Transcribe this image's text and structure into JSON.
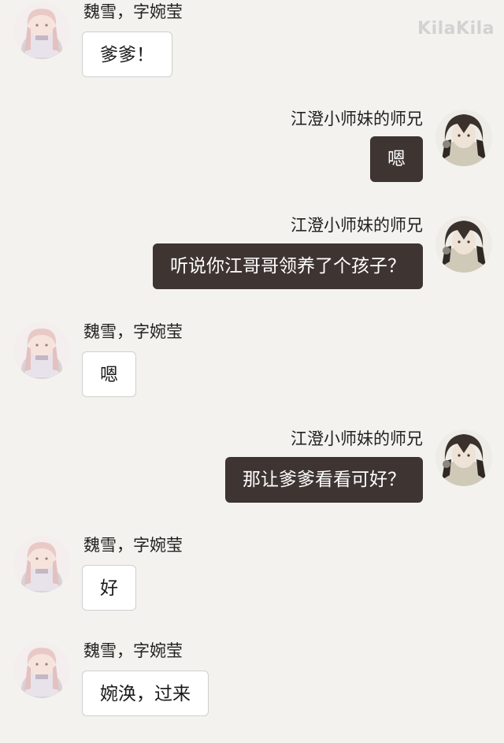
{
  "watermark": "KilaKila",
  "participants": {
    "female": {
      "name": "魏雪，字婉莹",
      "avatar_icon": "avatar-pink-hair-girl-icon"
    },
    "male": {
      "name": "江澄小师妹的师兄",
      "avatar_icon": "avatar-dark-hair-man-icon"
    }
  },
  "messages": [
    {
      "side": "left",
      "name": "魏雪，字婉莹",
      "text": "爹爹！"
    },
    {
      "side": "right",
      "name": "江澄小师妹的师兄",
      "text": "嗯"
    },
    {
      "side": "right",
      "name": "江澄小师妹的师兄",
      "text": "听说你江哥哥领养了个孩子？"
    },
    {
      "side": "left",
      "name": "魏雪，字婉莹",
      "text": "嗯"
    },
    {
      "side": "right",
      "name": "江澄小师妹的师兄",
      "text": "那让爹爹看看可好？"
    },
    {
      "side": "left",
      "name": "魏雪，字婉莹",
      "text": "好"
    },
    {
      "side": "left",
      "name": "魏雪，字婉莹",
      "text": "婉涣，过来"
    }
  ],
  "colors": {
    "background": "#f3f2ee",
    "left_bubble": "#ffffff",
    "right_bubble": "#3e3432"
  }
}
